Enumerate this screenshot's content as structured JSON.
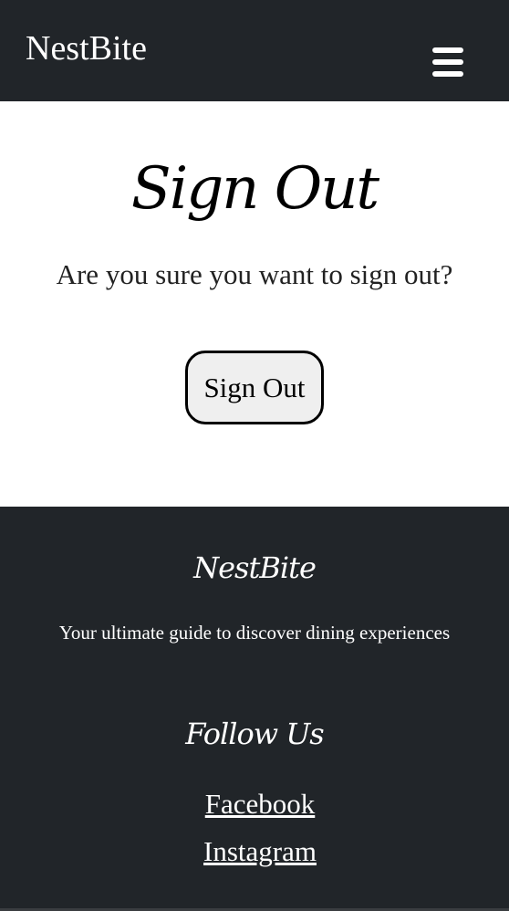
{
  "navbar": {
    "brand": "NestBite",
    "menu_icon": "hamburger-menu-icon"
  },
  "main": {
    "title": "Sign Out",
    "confirm_text": "Are you sure you want to sign out?",
    "signout_button_label": "Sign Out"
  },
  "footer": {
    "brand": "NestBite",
    "tagline": "Your ultimate guide to discover dining experiences",
    "follow_title": "Follow Us",
    "links": [
      {
        "label": "Facebook"
      },
      {
        "label": "Instagram"
      }
    ]
  },
  "colors": {
    "header_bg": "#212529",
    "footer_bg": "#212529",
    "page_bg": "#ffffff",
    "button_bg": "#efefef",
    "button_border": "#000000"
  }
}
